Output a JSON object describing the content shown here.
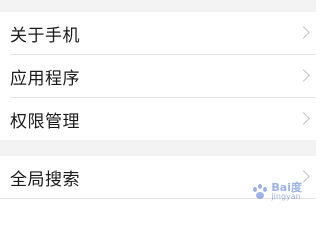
{
  "settings": {
    "group1": [
      {
        "label": "关于手机",
        "icon": "chevron-right-icon"
      },
      {
        "label": "应用程序",
        "icon": "chevron-right-icon"
      },
      {
        "label": "权限管理",
        "icon": "chevron-right-icon"
      }
    ],
    "group2": [
      {
        "label": "全局搜索",
        "icon": "chevron-right-icon"
      }
    ]
  },
  "watermark": {
    "brand": "Bai度",
    "sub": "jingyan"
  },
  "colors": {
    "background": "#f3f3f3",
    "row_background": "#ffffff",
    "text": "#1a1a1a",
    "chevron": "#c2c2c2",
    "divider": "#e2e2e2"
  }
}
